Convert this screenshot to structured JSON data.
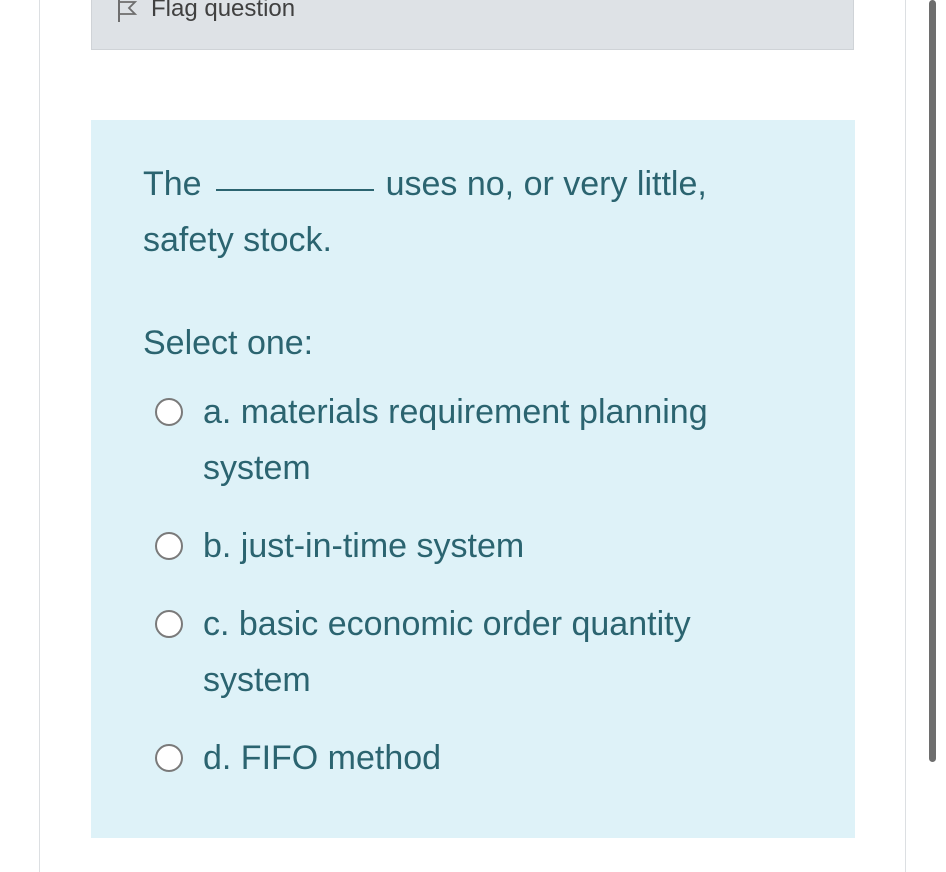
{
  "flag": {
    "label": "Flag question",
    "icon": "flag-icon"
  },
  "question": {
    "text_before": "The",
    "text_after_line1": "uses no, or very little,",
    "text_line2": "safety stock.",
    "prompt": "Select one:"
  },
  "options": [
    {
      "line1": "a. materials requirement planning",
      "line2": "system",
      "selected": false
    },
    {
      "line1": "b. just-in-time system",
      "selected": false
    },
    {
      "line1": "c. basic economic order quantity",
      "line2": "system",
      "selected": false
    },
    {
      "line1": "d. FIFO method",
      "selected": false
    }
  ],
  "colors": {
    "question_bg": "#def2f8",
    "text": "#2b6470",
    "info_bg": "#dee2e6"
  }
}
